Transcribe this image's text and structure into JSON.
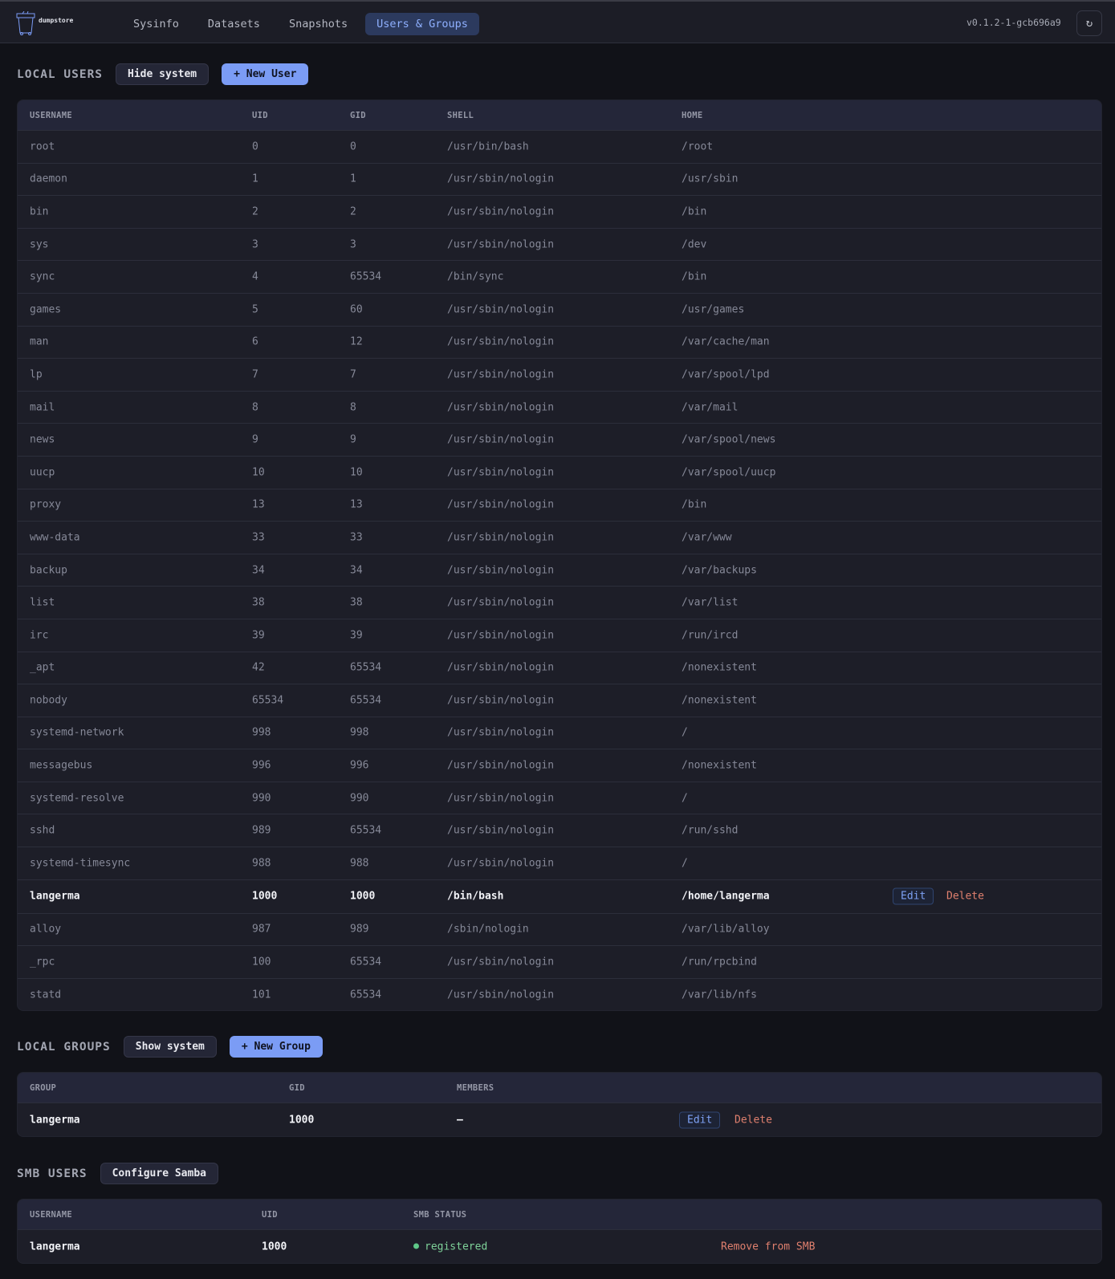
{
  "header": {
    "logo_text": "dumpstore",
    "nav": [
      "Sysinfo",
      "Datasets",
      "Snapshots",
      "Users & Groups"
    ],
    "active": "Users & Groups",
    "version": "v0.1.2-1-gcb696a9",
    "refresh_icon": "↻"
  },
  "local_users": {
    "title": "LOCAL USERS",
    "toggle": "Hide system",
    "new": "+ New User",
    "columns": [
      "USERNAME",
      "UID",
      "GID",
      "SHELL",
      "HOME"
    ],
    "rows": [
      [
        "root",
        "0",
        "0",
        "/usr/bin/bash",
        "/root",
        0
      ],
      [
        "daemon",
        "1",
        "1",
        "/usr/sbin/nologin",
        "/usr/sbin",
        0
      ],
      [
        "bin",
        "2",
        "2",
        "/usr/sbin/nologin",
        "/bin",
        0
      ],
      [
        "sys",
        "3",
        "3",
        "/usr/sbin/nologin",
        "/dev",
        0
      ],
      [
        "sync",
        "4",
        "65534",
        "/bin/sync",
        "/bin",
        0
      ],
      [
        "games",
        "5",
        "60",
        "/usr/sbin/nologin",
        "/usr/games",
        0
      ],
      [
        "man",
        "6",
        "12",
        "/usr/sbin/nologin",
        "/var/cache/man",
        0
      ],
      [
        "lp",
        "7",
        "7",
        "/usr/sbin/nologin",
        "/var/spool/lpd",
        0
      ],
      [
        "mail",
        "8",
        "8",
        "/usr/sbin/nologin",
        "/var/mail",
        0
      ],
      [
        "news",
        "9",
        "9",
        "/usr/sbin/nologin",
        "/var/spool/news",
        0
      ],
      [
        "uucp",
        "10",
        "10",
        "/usr/sbin/nologin",
        "/var/spool/uucp",
        0
      ],
      [
        "proxy",
        "13",
        "13",
        "/usr/sbin/nologin",
        "/bin",
        0
      ],
      [
        "www-data",
        "33",
        "33",
        "/usr/sbin/nologin",
        "/var/www",
        0
      ],
      [
        "backup",
        "34",
        "34",
        "/usr/sbin/nologin",
        "/var/backups",
        0
      ],
      [
        "list",
        "38",
        "38",
        "/usr/sbin/nologin",
        "/var/list",
        0
      ],
      [
        "irc",
        "39",
        "39",
        "/usr/sbin/nologin",
        "/run/ircd",
        0
      ],
      [
        "_apt",
        "42",
        "65534",
        "/usr/sbin/nologin",
        "/nonexistent",
        0
      ],
      [
        "nobody",
        "65534",
        "65534",
        "/usr/sbin/nologin",
        "/nonexistent",
        0
      ],
      [
        "systemd-network",
        "998",
        "998",
        "/usr/sbin/nologin",
        "/",
        0
      ],
      [
        "messagebus",
        "996",
        "996",
        "/usr/sbin/nologin",
        "/nonexistent",
        0
      ],
      [
        "systemd-resolve",
        "990",
        "990",
        "/usr/sbin/nologin",
        "/",
        0
      ],
      [
        "sshd",
        "989",
        "65534",
        "/usr/sbin/nologin",
        "/run/sshd",
        0
      ],
      [
        "systemd-timesync",
        "988",
        "988",
        "/usr/sbin/nologin",
        "/",
        0
      ],
      [
        "langerma",
        "1000",
        "1000",
        "/bin/bash",
        "/home/langerma",
        1
      ],
      [
        "alloy",
        "987",
        "989",
        "/sbin/nologin",
        "/var/lib/alloy",
        0
      ],
      [
        "_rpc",
        "100",
        "65534",
        "/usr/sbin/nologin",
        "/run/rpcbind",
        0
      ],
      [
        "statd",
        "101",
        "65534",
        "/usr/sbin/nologin",
        "/var/lib/nfs",
        0
      ]
    ],
    "edit": "Edit",
    "delete": "Delete"
  },
  "local_groups": {
    "title": "LOCAL GROUPS",
    "toggle": "Show system",
    "new": "+ New Group",
    "columns": [
      "GROUP",
      "GID",
      "MEMBERS"
    ],
    "rows": [
      [
        "langerma",
        "1000",
        "–"
      ]
    ],
    "edit": "Edit",
    "delete": "Delete"
  },
  "smb_users": {
    "title": "SMB USERS",
    "configure": "Configure Samba",
    "columns": [
      "USERNAME",
      "UID",
      "SMB STATUS"
    ],
    "rows": [
      [
        "langerma",
        "1000",
        "registered"
      ]
    ],
    "remove": "Remove from SMB",
    "status_color": "#5fc888"
  }
}
